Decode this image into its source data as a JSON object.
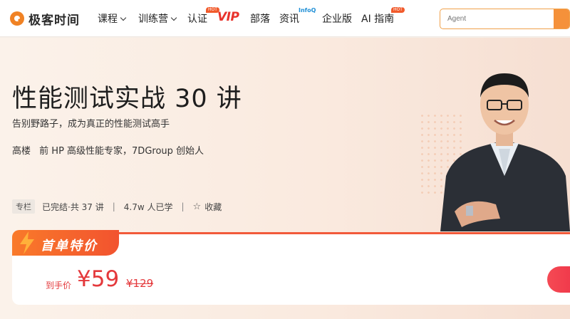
{
  "brand": {
    "name": "极客时间",
    "color": "#f08224"
  },
  "nav": {
    "items": [
      {
        "label": "课程",
        "dropdown": true
      },
      {
        "label": "训练营",
        "dropdown": true
      },
      {
        "label": "认证",
        "badge": "HOT"
      },
      {
        "label": "VIP"
      },
      {
        "label": "部落"
      },
      {
        "label": "资讯",
        "badge": "InfoQ"
      },
      {
        "label": "企业版"
      },
      {
        "label": "AI 指南",
        "badge": "HOT"
      }
    ]
  },
  "search": {
    "placeholder": "Agent",
    "icon": "search-icon"
  },
  "course": {
    "title": "性能测试实战 30 讲",
    "subtitle": "告别野路子，成为真正的性能测试高手",
    "author_name": "高楼",
    "author_bio": "前 HP 高级性能专家，7DGroup 创始人",
    "tag": "专栏",
    "status": "已完结·共 37 讲",
    "learners": "4.7w 人已学",
    "favorite": "收藏"
  },
  "pricing": {
    "promo": "首单特价",
    "label": "到手价",
    "current": "¥59",
    "original": "¥129"
  },
  "colors": {
    "accent": "#e4393c",
    "promo": "#f25a3a"
  }
}
